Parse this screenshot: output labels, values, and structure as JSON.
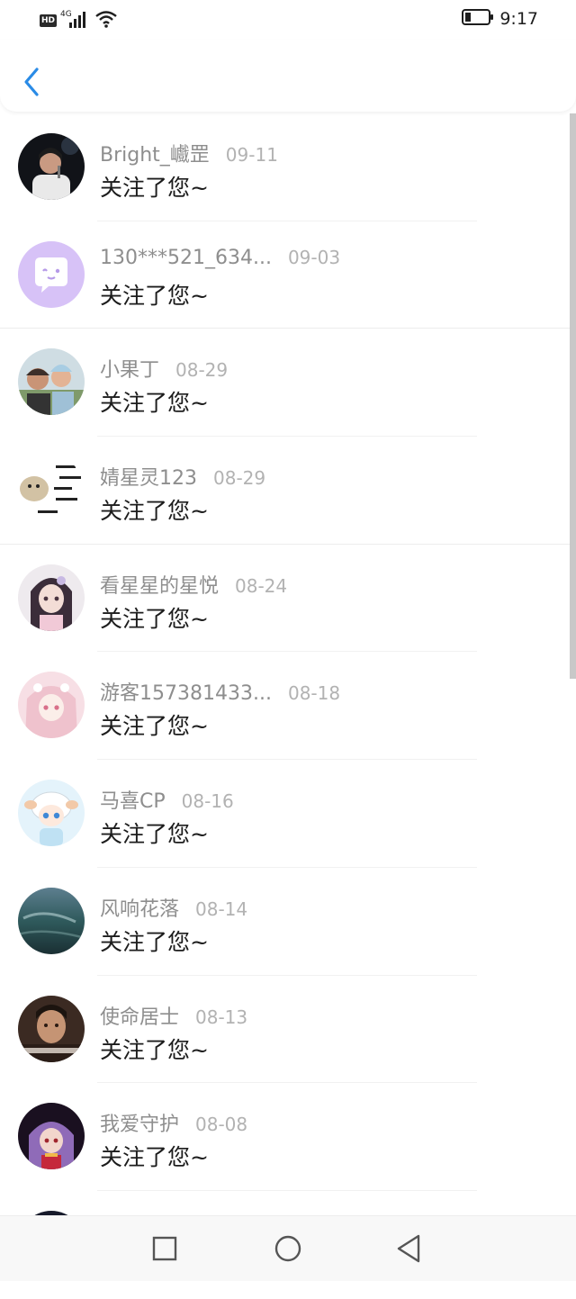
{
  "status_bar": {
    "hd_badge": "HD",
    "network": "4G",
    "time": "9:17",
    "icons": [
      "signal-icon",
      "wifi-icon",
      "battery-icon"
    ]
  },
  "header": {
    "back_icon": "chevron-left-icon",
    "accent_color": "#2a8be6"
  },
  "followers": [
    {
      "name": "Bright_巇罡",
      "date": "09-11",
      "message": "关注了您~",
      "avatar": "singer-photo"
    },
    {
      "name": "130***521_634...",
      "date": "09-03",
      "message": "关注了您~",
      "avatar": "default-chat-bubble"
    },
    {
      "name": "小果丁",
      "date": "08-29",
      "message": "关注了您~",
      "avatar": "two-people-photo"
    },
    {
      "name": "婧星灵123",
      "date": "08-29",
      "message": "关注了您~",
      "avatar": "sticker-meme"
    },
    {
      "name": "看星星的星悦",
      "date": "08-24",
      "message": "关注了您~",
      "avatar": "anime-girl"
    },
    {
      "name": "游客157381433...",
      "date": "08-18",
      "message": "关注了您~",
      "avatar": "anime-pink-girl"
    },
    {
      "name": "马喜CP",
      "date": "08-16",
      "message": "关注了您~",
      "avatar": "cartoon-sheep"
    },
    {
      "name": "风响花落",
      "date": "08-14",
      "message": "关注了您~",
      "avatar": "ocean-scene"
    },
    {
      "name": "使命居士",
      "date": "08-13",
      "message": "关注了您~",
      "avatar": "tv-drama-man"
    },
    {
      "name": "我爱守护",
      "date": "08-08",
      "message": "关注了您~",
      "avatar": "anime-purple-hair"
    }
  ],
  "nav_bar": {
    "buttons": [
      "recent-apps-icon",
      "home-icon",
      "back-triangle-icon"
    ]
  }
}
